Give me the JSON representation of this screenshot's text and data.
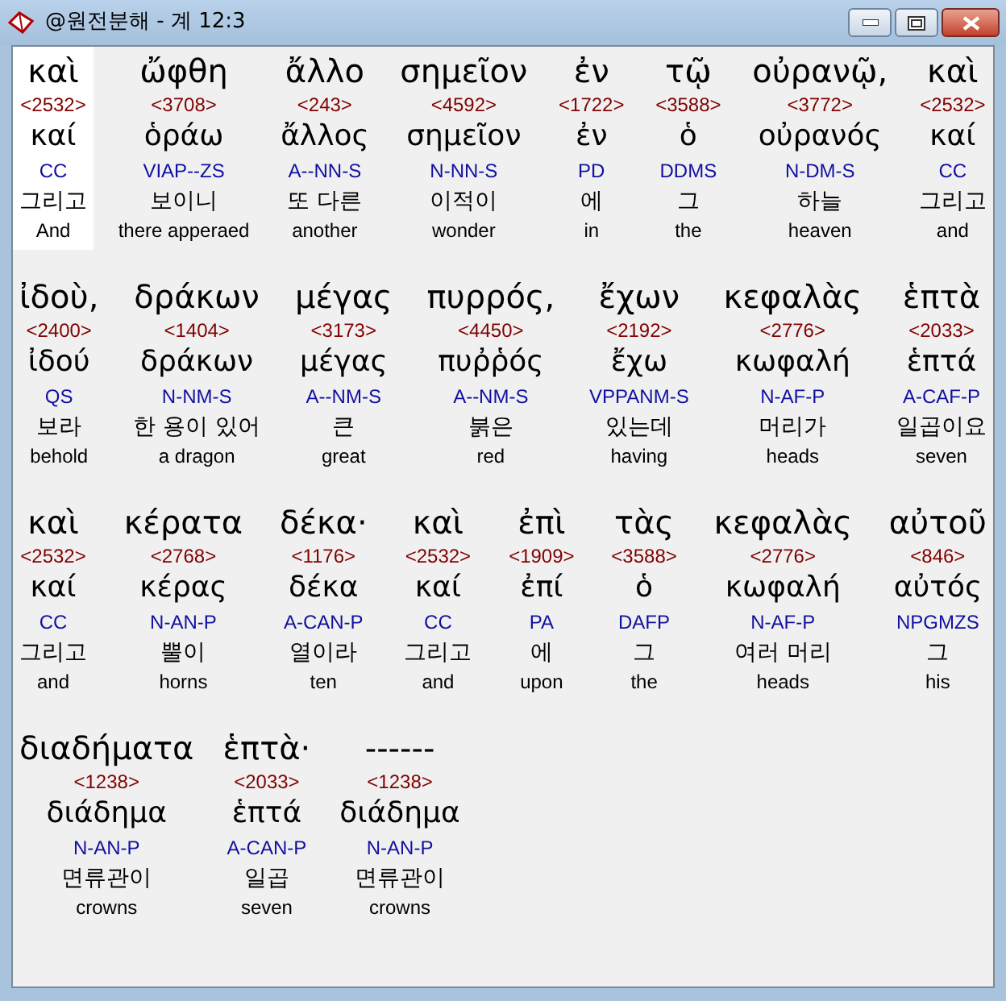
{
  "window": {
    "title": "@원전분해 - 계 12:3"
  },
  "lines": [
    [
      {
        "greek": "καὶ",
        "strongs": "<2532>",
        "lemma": "καί",
        "parse": "CC",
        "korean": "그리고",
        "english": "And",
        "selected": true
      },
      {
        "greek": "ὤφθη",
        "strongs": "<3708>",
        "lemma": "ὁράω",
        "parse": "VIAP--ZS",
        "korean": "보이니",
        "english": "there apperaed",
        "selected": false
      },
      {
        "greek": "ἄλλο",
        "strongs": "<243>",
        "lemma": "ἄλλος",
        "parse": "A--NN-S",
        "korean": "또 다른",
        "english": "another",
        "selected": false
      },
      {
        "greek": "σημεῖον",
        "strongs": "<4592>",
        "lemma": "σημεῖον",
        "parse": "N-NN-S",
        "korean": "이적이",
        "english": "wonder",
        "selected": false
      },
      {
        "greek": "ἐν",
        "strongs": "<1722>",
        "lemma": "ἐν",
        "parse": "PD",
        "korean": "에",
        "english": "in",
        "selected": false
      },
      {
        "greek": "τῷ",
        "strongs": "<3588>",
        "lemma": "ὁ",
        "parse": "DDMS",
        "korean": "그",
        "english": "the",
        "selected": false
      },
      {
        "greek": "οὐρανῷ,",
        "strongs": "<3772>",
        "lemma": "οὐρανός",
        "parse": "N-DM-S",
        "korean": "하늘",
        "english": "heaven",
        "selected": false
      },
      {
        "greek": "καὶ",
        "strongs": "<2532>",
        "lemma": "καί",
        "parse": "CC",
        "korean": "그리고",
        "english": "and",
        "selected": false
      }
    ],
    [
      {
        "greek": "ἰδοὺ,",
        "strongs": "<2400>",
        "lemma": "ἰδού",
        "parse": "QS",
        "korean": "보라",
        "english": "behold",
        "selected": false
      },
      {
        "greek": "δράκων",
        "strongs": "<1404>",
        "lemma": "δράκων",
        "parse": "N-NM-S",
        "korean": "한 용이 있어",
        "english": "a dragon",
        "selected": false
      },
      {
        "greek": "μέγας",
        "strongs": "<3173>",
        "lemma": "μέγας",
        "parse": "A--NM-S",
        "korean": "큰",
        "english": "great",
        "selected": false
      },
      {
        "greek": "πυρρός,",
        "strongs": "<4450>",
        "lemma": "πυῤῥός",
        "parse": "A--NM-S",
        "korean": "붉은",
        "english": "red",
        "selected": false
      },
      {
        "greek": "ἔχων",
        "strongs": "<2192>",
        "lemma": "ἔχω",
        "parse": "VPPANM-S",
        "korean": "있는데",
        "english": "having",
        "selected": false
      },
      {
        "greek": "κεφαλὰς",
        "strongs": "<2776>",
        "lemma": "κωφαλή",
        "parse": "N-AF-P",
        "korean": "머리가",
        "english": "heads",
        "selected": false
      },
      {
        "greek": "ἑπτὰ",
        "strongs": "<2033>",
        "lemma": "ἑπτά",
        "parse": "A-CAF-P",
        "korean": "일곱이요",
        "english": "seven",
        "selected": false
      }
    ],
    [
      {
        "greek": "καὶ",
        "strongs": "<2532>",
        "lemma": "καί",
        "parse": "CC",
        "korean": "그리고",
        "english": "and",
        "selected": false
      },
      {
        "greek": "κέρατα",
        "strongs": "<2768>",
        "lemma": "κέρας",
        "parse": "N-AN-P",
        "korean": "뿔이",
        "english": "horns",
        "selected": false
      },
      {
        "greek": "δέκα·",
        "strongs": "<1176>",
        "lemma": "δέκα",
        "parse": "A-CAN-P",
        "korean": "열이라",
        "english": "ten",
        "selected": false
      },
      {
        "greek": "καὶ",
        "strongs": "<2532>",
        "lemma": "καί",
        "parse": "CC",
        "korean": "그리고",
        "english": "and",
        "selected": false
      },
      {
        "greek": "ἐπὶ",
        "strongs": "<1909>",
        "lemma": "ἐπί",
        "parse": "PA",
        "korean": "에",
        "english": "upon",
        "selected": false
      },
      {
        "greek": "τὰς",
        "strongs": "<3588>",
        "lemma": "ὁ",
        "parse": "DAFP",
        "korean": "그",
        "english": "the",
        "selected": false
      },
      {
        "greek": "κεφαλὰς",
        "strongs": "<2776>",
        "lemma": "κωφαλή",
        "parse": "N-AF-P",
        "korean": "여러 머리",
        "english": "heads",
        "selected": false
      },
      {
        "greek": "αὐτοῦ",
        "strongs": "<846>",
        "lemma": "αὐτός",
        "parse": "NPGMZS",
        "korean": "그",
        "english": "his",
        "selected": false
      }
    ],
    [
      {
        "greek": "διαδήματα",
        "strongs": "<1238>",
        "lemma": "διάδημα",
        "parse": "N-AN-P",
        "korean": "면류관이",
        "english": "crowns",
        "selected": false
      },
      {
        "greek": "ἑπτὰ·",
        "strongs": "<2033>",
        "lemma": "ἑπτά",
        "parse": "A-CAN-P",
        "korean": "일곱",
        "english": "seven",
        "selected": false
      },
      {
        "greek": "------",
        "strongs": "<1238>",
        "lemma": "διάδημα",
        "parse": "N-AN-P",
        "korean": "면류관이",
        "english": "crowns",
        "selected": false
      }
    ]
  ]
}
